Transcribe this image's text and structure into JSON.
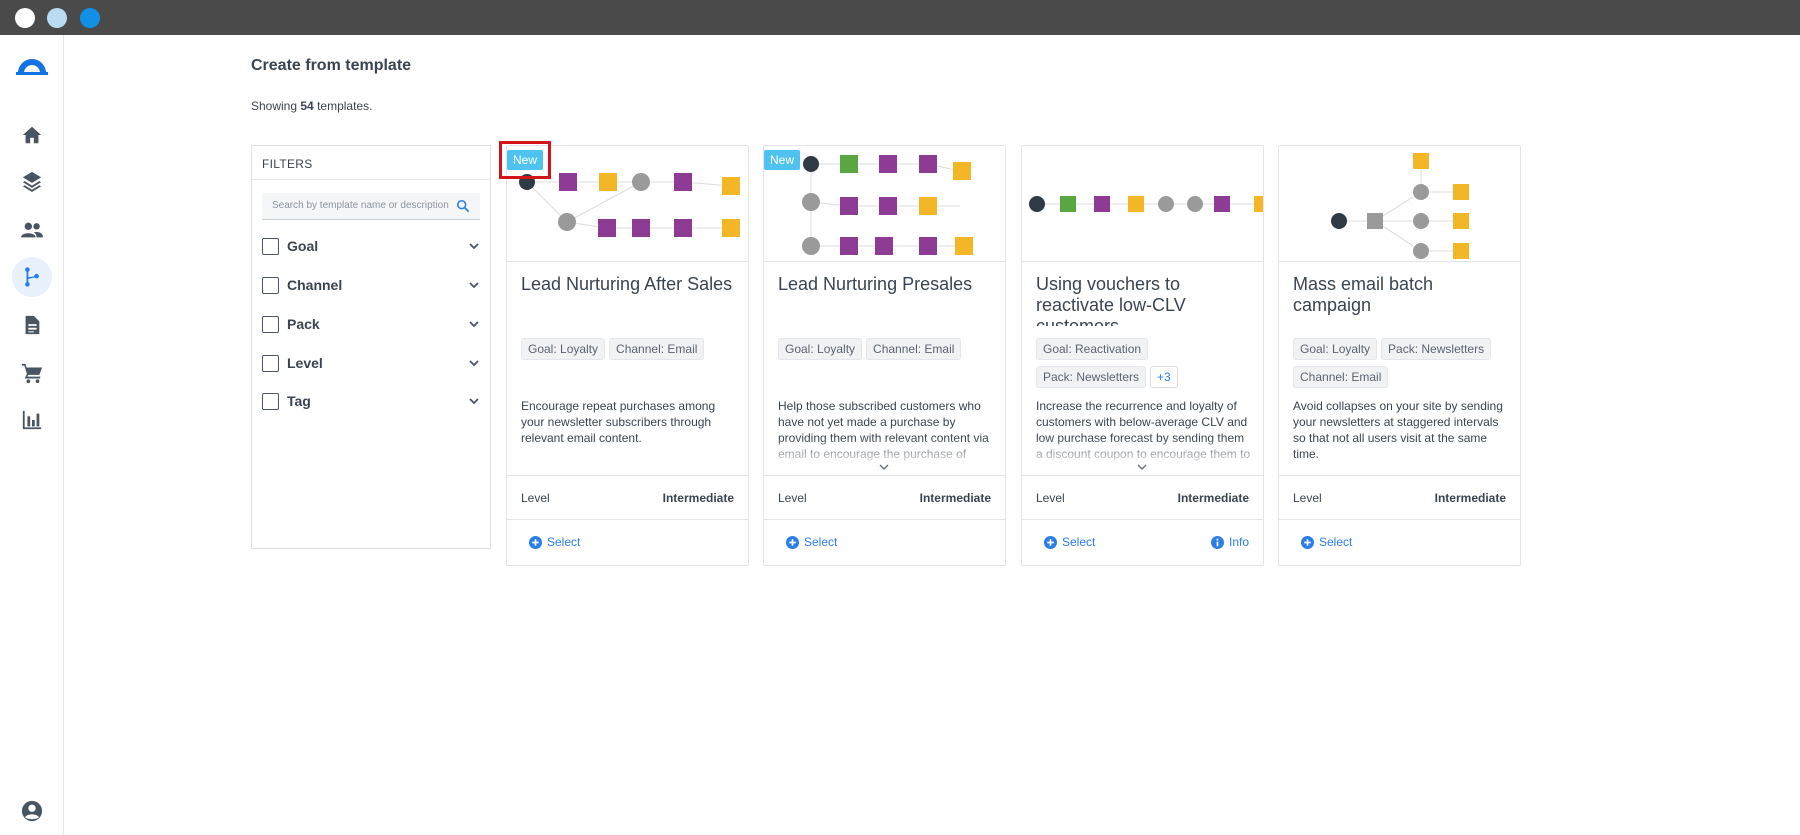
{
  "window": {
    "dots": [
      "#ffffff",
      "#b9dcf3",
      "#1190e6"
    ]
  },
  "sidebar": {
    "items": [
      {
        "icon": "home-icon"
      },
      {
        "icon": "layers-icon"
      },
      {
        "icon": "people-icon"
      },
      {
        "icon": "workflow-icon",
        "active": true
      },
      {
        "icon": "document-icon"
      },
      {
        "icon": "cart-icon"
      },
      {
        "icon": "bar-chart-icon"
      }
    ],
    "user_icon": "user-account-icon"
  },
  "page": {
    "title": "Create from template",
    "showing_prefix": "Showing ",
    "showing_count": "54",
    "showing_suffix": " templates."
  },
  "filters": {
    "header": "FILTERS",
    "search_placeholder": "Search by template name or description",
    "groups": [
      {
        "label": "Goal"
      },
      {
        "label": "Channel"
      },
      {
        "label": "Pack"
      },
      {
        "label": "Level"
      },
      {
        "label": "Tag"
      }
    ]
  },
  "cards": [
    {
      "badge": "New",
      "title": "Lead Nurturing After Sales",
      "tags": [
        "Goal: Loyalty",
        "Channel: Email"
      ],
      "description": "Encourage repeat purchases among your newsletter subscribers through relevant email content.",
      "level_label": "Level",
      "level_value": "Intermediate",
      "select_label": "Select"
    },
    {
      "badge": "New",
      "title": "Lead Nurturing Presales",
      "tags": [
        "Goal: Loyalty",
        "Channel: Email"
      ],
      "description": "Help those subscribed customers who have not yet made a purchase by providing them with relevant content via email to encourage the purchase of",
      "level_label": "Level",
      "level_value": "Intermediate",
      "select_label": "Select"
    },
    {
      "title": "Using vouchers to reactivate low-CLV customers",
      "tags": [
        "Goal: Reactivation",
        "Pack: Newsletters"
      ],
      "tags_more": "+3",
      "description": "Increase the recurrence and loyalty of customers with below-average CLV and low purchase forecast by sending them a discount coupon to encourage them to",
      "level_label": "Level",
      "level_value": "Intermediate",
      "select_label": "Select",
      "info_label": "Info"
    },
    {
      "title": "Mass email batch campaign",
      "tags": [
        "Goal: Loyalty",
        "Pack: Newsletters",
        "Channel: Email"
      ],
      "description": "Avoid collapses on your site by sending your newsletters at staggered intervals so that not all users visit at the same time.",
      "level_label": "Level",
      "level_value": "Intermediate",
      "select_label": "Select"
    }
  ],
  "colors": {
    "accent": "#2b7ee9",
    "badge": "#4fc3f0",
    "highlight": "#d4141a",
    "node_purple": "#8e3b96",
    "node_yellow": "#f3b626",
    "node_gray": "#9a9a9a",
    "node_green": "#5aa643",
    "node_dark": "#2e3a45"
  }
}
